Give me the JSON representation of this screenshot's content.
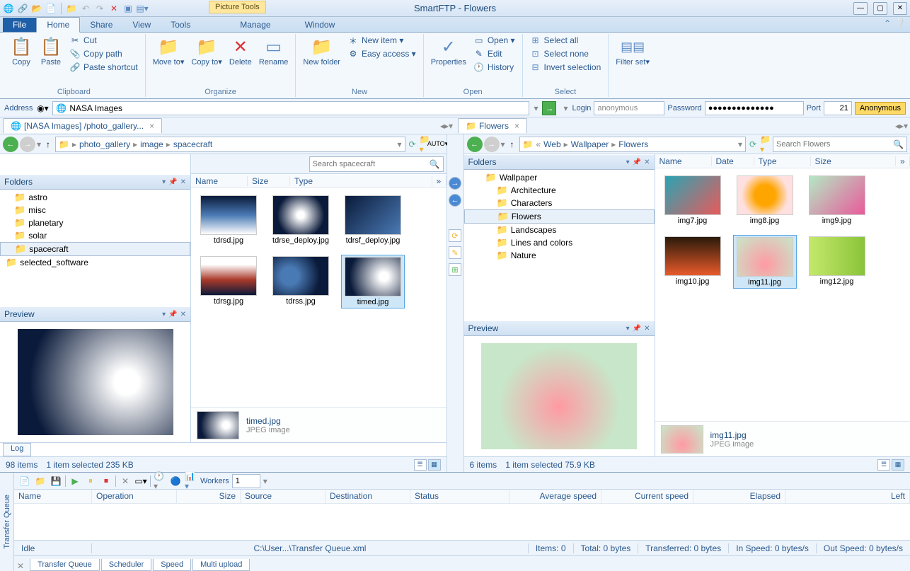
{
  "app_title": "SmartFTP - Flowers",
  "picture_tools": "Picture Tools",
  "tabs": {
    "file": "File",
    "home": "Home",
    "share": "Share",
    "view": "View",
    "tools": "Tools",
    "manage": "Manage",
    "window": "Window"
  },
  "ribbon": {
    "clipboard": {
      "label": "Clipboard",
      "copy": "Copy",
      "paste": "Paste",
      "cut": "Cut",
      "copy_path": "Copy path",
      "paste_shortcut": "Paste shortcut"
    },
    "organize": {
      "label": "Organize",
      "move_to": "Move to▾",
      "copy_to": "Copy to▾",
      "delete": "Delete",
      "rename": "Rename"
    },
    "new": {
      "label": "New",
      "new_folder": "New folder",
      "new_item": "New item ▾",
      "easy_access": "Easy access ▾"
    },
    "open": {
      "label": "Open",
      "properties": "Properties",
      "open": "Open ▾",
      "edit": "Edit",
      "history": "History"
    },
    "select": {
      "label": "Select",
      "select_all": "Select all",
      "select_none": "Select none",
      "invert": "Invert selection"
    },
    "groove": {
      "filter_set": "Filter set▾"
    }
  },
  "address": {
    "label": "Address",
    "value": "NASA Images",
    "login_label": "Login",
    "login_value": "anonymous",
    "password_label": "Password",
    "password_value": "●●●●●●●●●●●●●●",
    "port_label": "Port",
    "port_value": "21",
    "anonymous": "Anonymous"
  },
  "left_pane": {
    "tab": "[NASA Images] /photo_gallery...",
    "breadcrumb": [
      "photo_gallery",
      "image",
      "spacecraft"
    ],
    "search_placeholder": "Search spacecraft",
    "folders_title": "Folders",
    "folders": [
      "astro",
      "misc",
      "planetary",
      "solar",
      "spacecraft",
      "selected_software"
    ],
    "folder_selected": "spacecraft",
    "preview_title": "Preview",
    "columns": [
      "Name",
      "Size",
      "Type"
    ],
    "files": [
      "tdrsd.jpg",
      "tdrse_deploy.jpg",
      "tdrsf_deploy.jpg",
      "tdrsg.jpg",
      "tdrss.jpg",
      "timed.jpg"
    ],
    "detail_name": "timed.jpg",
    "detail_type": "JPEG image",
    "log_tab": "Log",
    "status_items": "98 items",
    "status_sel": "1 item selected  235 KB"
  },
  "right_pane": {
    "tab": "Flowers",
    "breadcrumb": [
      "Web",
      "Wallpaper",
      "Flowers"
    ],
    "search_placeholder": "Search Flowers",
    "folders_title": "Folders",
    "folder_root": "Wallpaper",
    "folders": [
      "Architecture",
      "Characters",
      "Flowers",
      "Landscapes",
      "Lines and colors",
      "Nature"
    ],
    "folder_selected": "Flowers",
    "preview_title": "Preview",
    "columns": [
      "Name",
      "Date",
      "Type",
      "Size"
    ],
    "files": [
      "img7.jpg",
      "img8.jpg",
      "img9.jpg",
      "img10.jpg",
      "img11.jpg",
      "img12.jpg"
    ],
    "file_selected": "img11.jpg",
    "detail_name": "img11.jpg",
    "detail_type": "JPEG image",
    "status_items": "6 items",
    "status_sel": "1 item selected  75.9 KB"
  },
  "tq": {
    "side": "Transfer Queue",
    "workers_label": "Workers",
    "workers_value": "1",
    "columns": [
      "Name",
      "Operation",
      "Size",
      "Source",
      "Destination",
      "Status",
      "Average speed",
      "Current speed",
      "Elapsed",
      "Left"
    ],
    "status_idle": "Idle",
    "status_path": "C:\\User...\\Transfer Queue.xml",
    "status_items": "Items: 0",
    "status_total": "Total: 0 bytes",
    "status_transferred": "Transferred: 0 bytes",
    "status_in": "In Speed: 0 bytes/s",
    "status_out": "Out Speed: 0 bytes/s",
    "tabs": [
      "Transfer Queue",
      "Scheduler",
      "Speed",
      "Multi upload"
    ]
  }
}
